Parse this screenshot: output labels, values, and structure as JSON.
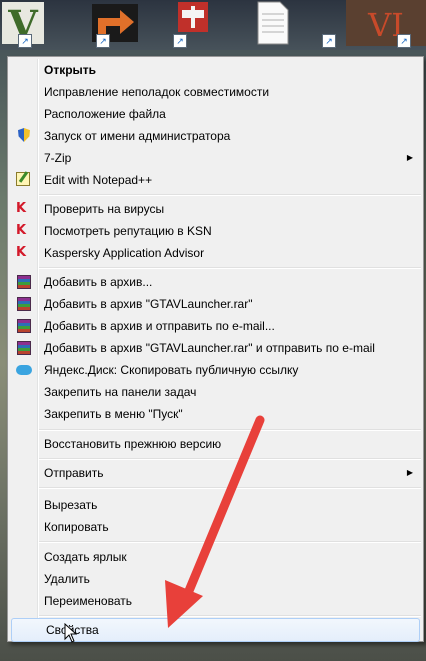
{
  "desktop": {
    "icons": [
      {
        "name": "gtav-launcher-icon",
        "glyph": "V"
      },
      {
        "name": "orange-arrow-app-icon",
        "glyph": ""
      },
      {
        "name": "castle-crashers-icon",
        "glyph": ""
      },
      {
        "name": "text-document-icon",
        "glyph": ""
      },
      {
        "name": "game-poster-icon",
        "glyph": "VI"
      }
    ]
  },
  "menu": {
    "items": [
      {
        "label": "Открыть",
        "bold": true,
        "icon": ""
      },
      {
        "label": "Исправление неполадок совместимости",
        "icon": ""
      },
      {
        "label": "Расположение файла",
        "icon": ""
      },
      {
        "label": "Запуск от имени администратора",
        "icon": "shield-icon"
      },
      {
        "label": "7-Zip",
        "icon": "",
        "submenu": true
      },
      {
        "label": "Edit with Notepad++",
        "icon": "notepad-plus-icon"
      },
      {
        "label": "Проверить на вирусы",
        "icon": "kaspersky-icon"
      },
      {
        "label": "Посмотреть репутацию в KSN",
        "icon": "kaspersky-icon"
      },
      {
        "label": "Kaspersky Application Advisor",
        "icon": "kaspersky-icon"
      },
      {
        "label": "Добавить в архив...",
        "icon": "winrar-icon"
      },
      {
        "label": "Добавить в архив \"GTAVLauncher.rar\"",
        "icon": "winrar-icon"
      },
      {
        "label": "Добавить в архив и отправить по e-mail...",
        "icon": "winrar-icon"
      },
      {
        "label": "Добавить в архив \"GTAVLauncher.rar\" и отправить по e-mail",
        "icon": "winrar-icon"
      },
      {
        "label": "Яндекс.Диск: Скопировать публичную ссылку",
        "icon": "yandex-disk-icon"
      },
      {
        "label": "Закрепить на панели задач",
        "icon": ""
      },
      {
        "label": "Закрепить в меню \"Пуск\"",
        "icon": ""
      },
      {
        "label": "Восстановить прежнюю версию",
        "icon": ""
      },
      {
        "label": "Отправить",
        "icon": "",
        "submenu": true
      },
      {
        "label": "Вырезать",
        "icon": ""
      },
      {
        "label": "Копировать",
        "icon": ""
      },
      {
        "label": "Создать ярлык",
        "icon": ""
      },
      {
        "label": "Удалить",
        "icon": ""
      },
      {
        "label": "Переименовать",
        "icon": ""
      },
      {
        "label": "Свойства",
        "icon": "",
        "highlighted": true
      }
    ],
    "submenu_glyph": "▶"
  },
  "colors": {
    "annotation_arrow": "#e8403a",
    "highlight_border": "#aecff7"
  }
}
